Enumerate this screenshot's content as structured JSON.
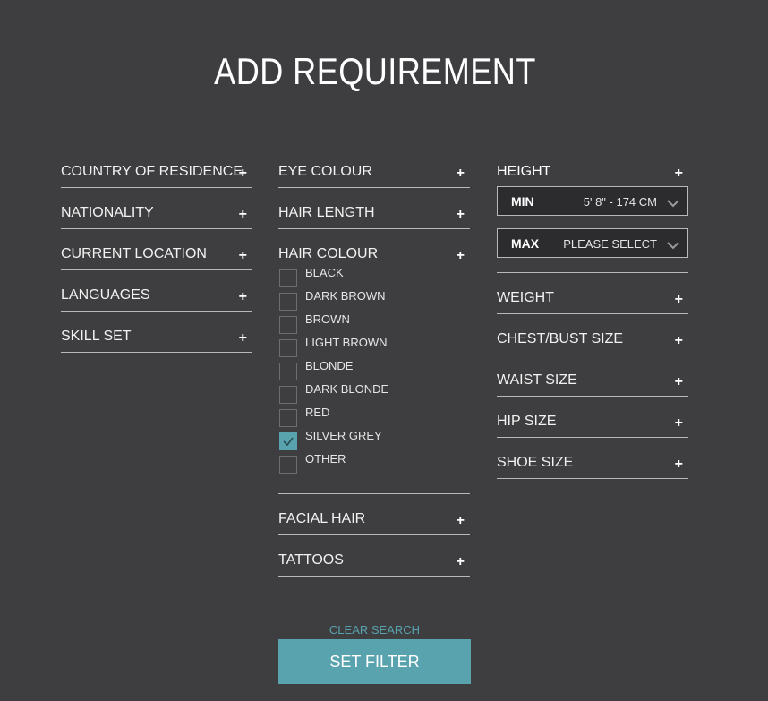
{
  "title": "ADD REQUIREMENT",
  "col1": [
    {
      "label": "COUNTRY OF RESIDENCE"
    },
    {
      "label": "NATIONALITY"
    },
    {
      "label": "CURRENT LOCATION"
    },
    {
      "label": "LANGUAGES"
    },
    {
      "label": "SKILL SET"
    }
  ],
  "col2": {
    "eye_colour": "EYE COLOUR",
    "hair_length": "HAIR LENGTH",
    "hair_colour": "HAIR COLOUR",
    "hair_options": [
      {
        "label": "BLACK",
        "checked": false
      },
      {
        "label": "DARK BROWN",
        "checked": false
      },
      {
        "label": "BROWN",
        "checked": false
      },
      {
        "label": "LIGHT BROWN",
        "checked": false
      },
      {
        "label": "BLONDE",
        "checked": false
      },
      {
        "label": "DARK BLONDE",
        "checked": false
      },
      {
        "label": "RED",
        "checked": false
      },
      {
        "label": "SILVER GREY",
        "checked": true
      },
      {
        "label": "OTHER",
        "checked": false
      }
    ],
    "facial_hair": "FACIAL HAIR",
    "tattoos": "TATTOOS"
  },
  "col3": {
    "height": "HEIGHT",
    "min_key": "MIN",
    "min_value": "5' 8\" - 174 CM",
    "max_key": "MAX",
    "max_value": "PLEASE SELECT",
    "rows": [
      {
        "label": "WEIGHT"
      },
      {
        "label": "CHEST/BUST SIZE"
      },
      {
        "label": "WAIST SIZE"
      },
      {
        "label": "HIP SIZE"
      },
      {
        "label": "SHOE SIZE"
      }
    ]
  },
  "plus_symbol": "+",
  "clear_search": "CLEAR SEARCH",
  "set_filter": "SET FILTER",
  "colors": {
    "background": "#3e3e40",
    "accent": "#58a3ae"
  }
}
